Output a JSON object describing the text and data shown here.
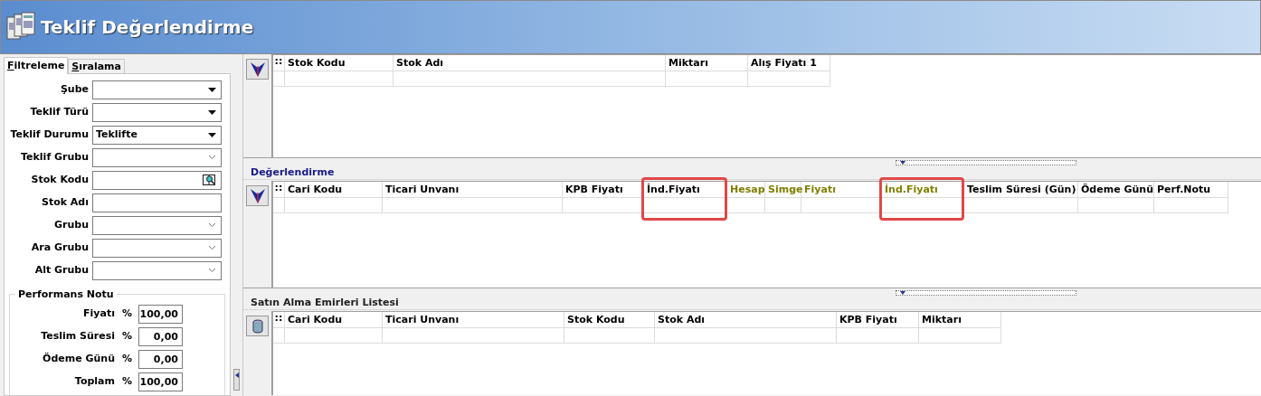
{
  "window": {
    "title": "Teklif Değerlendirme"
  },
  "tabs": [
    {
      "label": "Filtreleme",
      "selected": true
    },
    {
      "label": "Sıralama",
      "selected": false
    }
  ],
  "filters": [
    {
      "label": "Şube",
      "kind": "dropdown"
    },
    {
      "label": "Teklif Türü",
      "kind": "dropdown"
    },
    {
      "label": "Teklif Durumu",
      "kind": "dropdown",
      "value": "Teklifte"
    },
    {
      "label": "Teklif Grubu",
      "kind": "combo"
    },
    {
      "label": "Stok Kodu",
      "kind": "lookup"
    },
    {
      "label": "Stok Adı",
      "kind": "text"
    },
    {
      "label": "Grubu",
      "kind": "combo"
    },
    {
      "label": "Ara Grubu",
      "kind": "combo"
    },
    {
      "label": "Alt Grubu",
      "kind": "combo"
    }
  ],
  "performance": {
    "title": "Performans Notu",
    "rows": [
      {
        "label": "Fiyatı",
        "unit": "%",
        "value": "100,00"
      },
      {
        "label": "Teslim Süresi",
        "unit": "%",
        "value": "0,00"
      },
      {
        "label": "Ödeme Günü",
        "unit": "%",
        "value": "0,00"
      },
      {
        "label": "Toplam",
        "unit": "%",
        "value": "100,00"
      }
    ]
  },
  "grids": [
    {
      "marker": "::",
      "columns": [
        {
          "label": "Stok Kodu"
        },
        {
          "label": "Stok Adı"
        },
        {
          "label": "Miktarı"
        },
        {
          "label": "Alış Fiyatı 1"
        }
      ]
    },
    {
      "title": "Değerlendirme",
      "marker": "::",
      "columns": [
        {
          "label": "Cari Kodu"
        },
        {
          "label": "Ticari Unvanı"
        },
        {
          "label": "KPB Fiyatı"
        },
        {
          "label": "İnd.Fiyatı",
          "highlighted": true
        },
        {
          "label": "Hesap",
          "color": "#808000"
        },
        {
          "label": "Simge",
          "color": "#808000"
        },
        {
          "label": "Fiyatı",
          "color": "#808000"
        },
        {
          "label": "İnd.Fiyatı",
          "color": "#808000",
          "highlighted": true
        },
        {
          "label": "Teslim Süresi (Gün)"
        },
        {
          "label": "Ödeme Günü"
        },
        {
          "label": "Perf.Notu"
        }
      ]
    },
    {
      "title": "Satın Alma Emirleri Listesi",
      "marker": "::",
      "columns": [
        {
          "label": "Cari Kodu"
        },
        {
          "label": "Ticari Unvanı"
        },
        {
          "label": "Stok Kodu"
        },
        {
          "label": "Stok Adı"
        },
        {
          "label": "KPB Fiyatı"
        },
        {
          "label": "Miktarı"
        }
      ]
    }
  ]
}
